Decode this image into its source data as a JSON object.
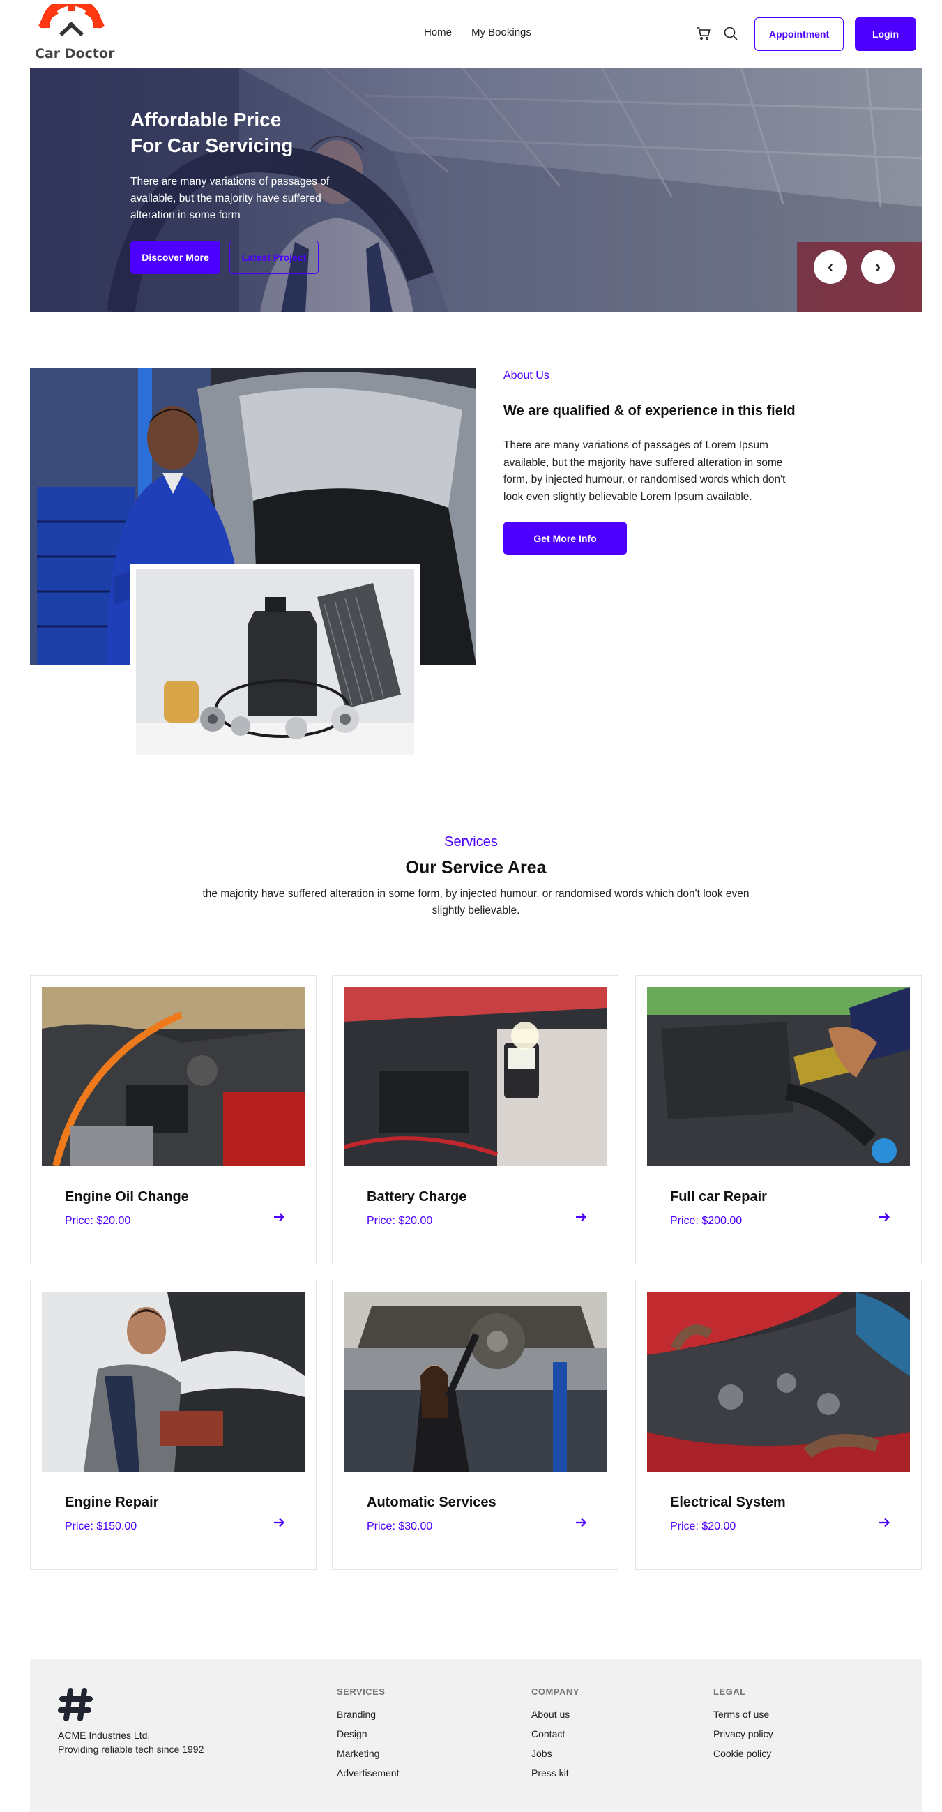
{
  "nav": {
    "logo_text": "Car Doctor",
    "links": [
      "Home",
      "My Bookings"
    ],
    "appointment_label": "Appointment",
    "login_label": "Login"
  },
  "hero": {
    "title_line1": "Affordable Price",
    "title_line2": "For Car Servicing",
    "text": "There are many variations of passages of available, but the majority have suffered alteration in some form",
    "discover_label": "Discover More",
    "latest_label": "Latest Project",
    "prev_glyph": "‹",
    "next_glyph": "›"
  },
  "about": {
    "label": "About Us",
    "title": "We are qualified & of experience in this field",
    "text": "There are many variations of passages of Lorem Ipsum available, but the majority have suffered alteration in some form, by injected humour, or randomised words which don't look even slightly believable Lorem Ipsum available.",
    "button_label": "Get More Info"
  },
  "services": {
    "label": "Services",
    "title": "Our Service Area",
    "subtitle": "the majority have suffered alteration in some form, by injected humour, or randomised words which don't look even slightly believable.",
    "items": [
      {
        "name": "Engine Oil Change",
        "price": "Price: $20.00"
      },
      {
        "name": "Battery Charge",
        "price": "Price: $20.00"
      },
      {
        "name": "Full car Repair",
        "price": "Price: $200.00"
      },
      {
        "name": "Engine Repair",
        "price": "Price: $150.00"
      },
      {
        "name": "Automatic Services",
        "price": "Price: $30.00"
      },
      {
        "name": "Electrical System",
        "price": "Price: $20.00"
      }
    ]
  },
  "footer": {
    "company_name": "ACME Industries Ltd.",
    "company_tagline": "Providing reliable tech since 1992",
    "services": {
      "heading": "SERVICES",
      "links": [
        "Branding",
        "Design",
        "Marketing",
        "Advertisement"
      ]
    },
    "company": {
      "heading": "COMPANY",
      "links": [
        "About us",
        "Contact",
        "Jobs",
        "Press kit"
      ]
    },
    "legal": {
      "heading": "LEGAL",
      "links": [
        "Terms of use",
        "Privacy policy",
        "Cookie policy"
      ]
    }
  },
  "colors": {
    "accent": "#4d00ff",
    "logo_red": "#ff3811",
    "footer_bg": "#f1f1f1"
  }
}
